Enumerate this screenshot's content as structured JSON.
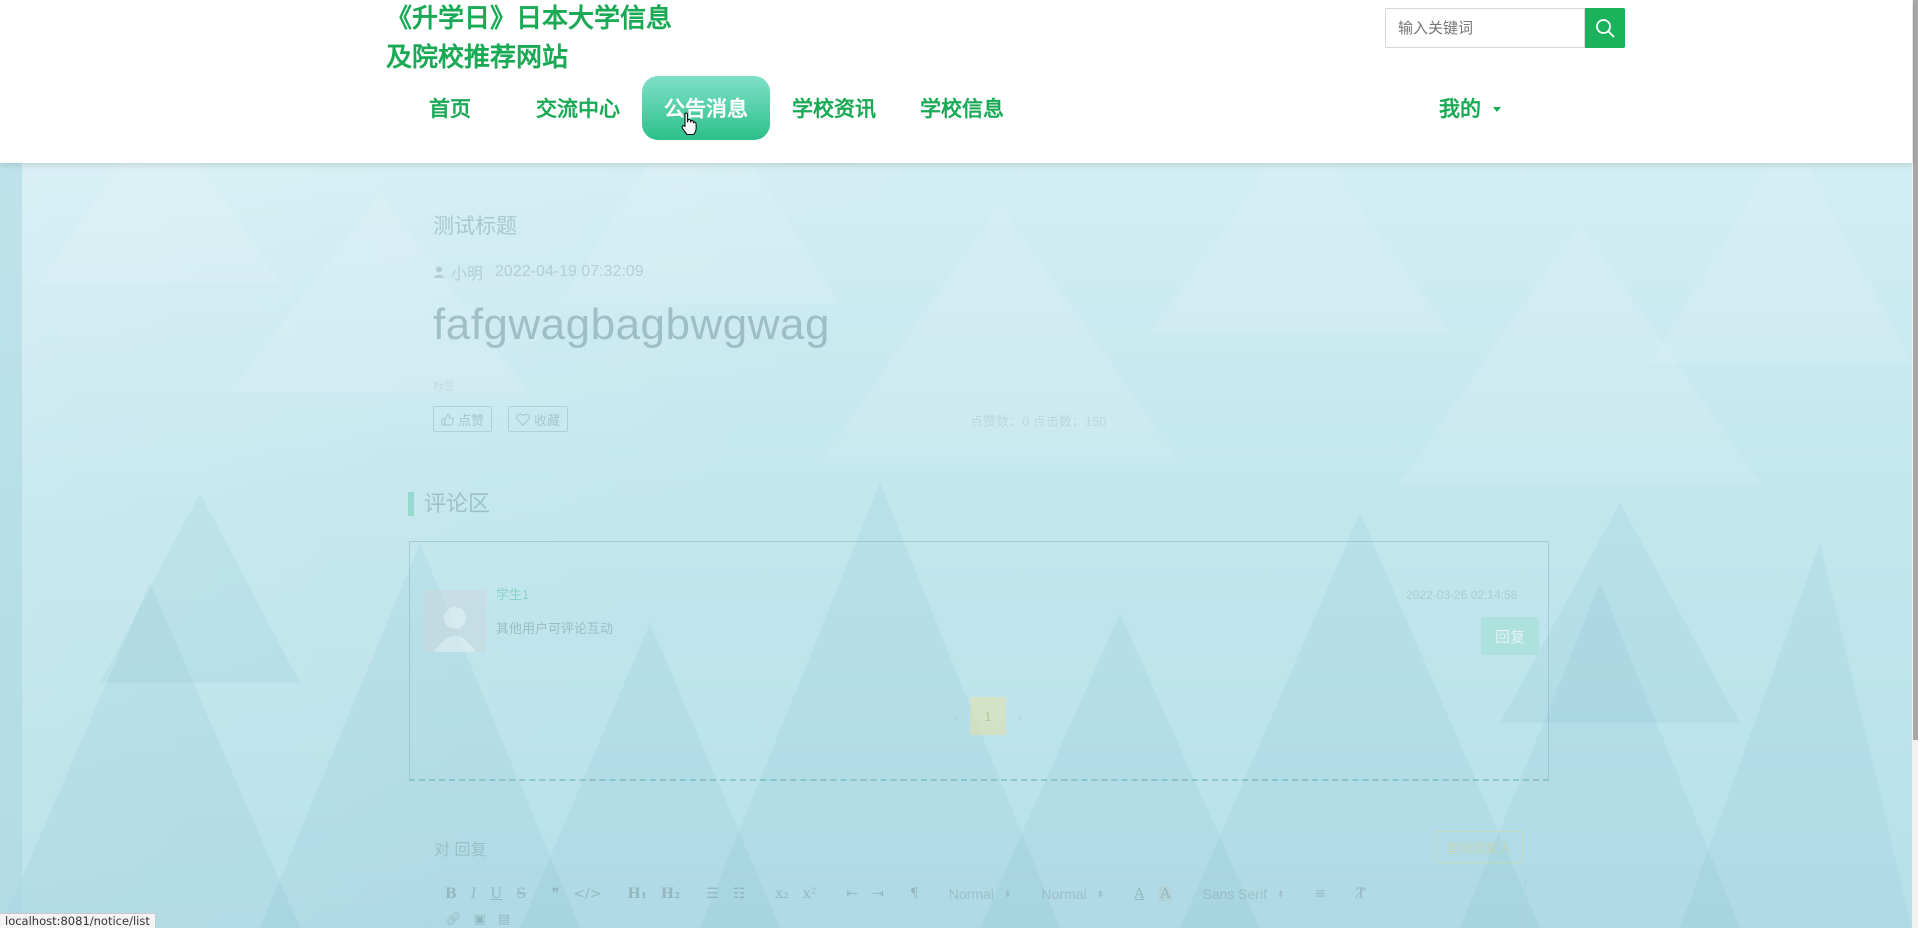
{
  "header": {
    "title_line1": "《升学日》日本大学信息",
    "title_line2": "及院校推荐网站",
    "search_placeholder": "输入关键词",
    "nav": [
      {
        "label": "首页",
        "active": false
      },
      {
        "label": "交流中心",
        "active": false
      },
      {
        "label": "公告消息",
        "active": true
      },
      {
        "label": "学校资讯",
        "active": false
      },
      {
        "label": "学校信息",
        "active": false
      }
    ],
    "account_label": "我的",
    "colors": {
      "brand_green": "#1aaa55",
      "active_nav": "#2cc08a"
    }
  },
  "article": {
    "title": "测试标题",
    "author": "小明",
    "date": "2022-04-19 07:32:09",
    "body": "fafgwagbagbwgwag",
    "tag_label": "标签",
    "like_label": "点赞",
    "favorite_label": "收藏",
    "stats": "点赞数：0  点击数：150"
  },
  "comments": {
    "section_title": "评论区",
    "items": [
      {
        "user": "学生1",
        "text": "其他用户可评论互动",
        "time": "2022-03-26 02:14:58",
        "reply_label": "回复"
      }
    ],
    "pager": {
      "prev": "‹",
      "current": "1",
      "next": "›"
    }
  },
  "reply_form": {
    "label": "对 回复",
    "clear_label": "重新回复人",
    "toolbar": {
      "header_select": "Normal",
      "size_select": "Normal",
      "font_select": "Sans Serif"
    }
  },
  "statusbar": {
    "url": "localhost:8081/notice/list"
  }
}
